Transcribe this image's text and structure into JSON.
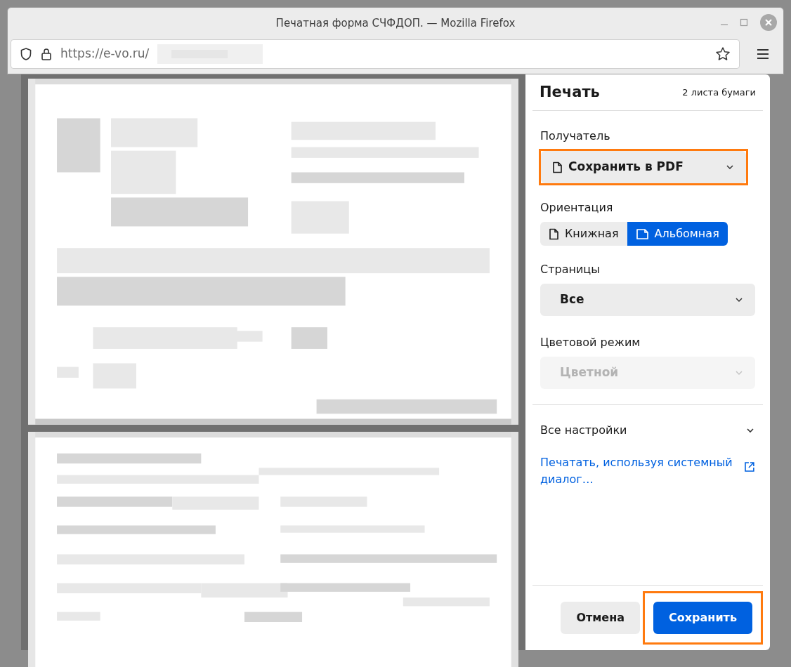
{
  "window": {
    "title": "Печатная форма СЧФДОП. — Mozilla Firefox"
  },
  "address_bar": {
    "url": "https://e-vo.ru/"
  },
  "print_panel": {
    "title": "Печать",
    "sheets": "2 листа бумаги",
    "destination": {
      "label": "Получатель",
      "value": "Сохранить в PDF",
      "highlighted": true
    },
    "orientation": {
      "label": "Ориентация",
      "options": [
        {
          "kind": "portrait",
          "label": "Книжная",
          "selected": false
        },
        {
          "kind": "landscape",
          "label": "Альбомная",
          "selected": true
        }
      ]
    },
    "pages": {
      "label": "Страницы",
      "value": "Все",
      "disabled": false
    },
    "color_mode": {
      "label": "Цветовой режим",
      "value": "Цветной",
      "disabled": true
    },
    "more_settings": {
      "label": "Все настройки",
      "expanded": false
    },
    "system_dialog_link": "Печатать, используя системный диалог…",
    "cancel_button": "Отмена",
    "save_button": {
      "label": "Сохранить",
      "highlighted": true
    }
  }
}
